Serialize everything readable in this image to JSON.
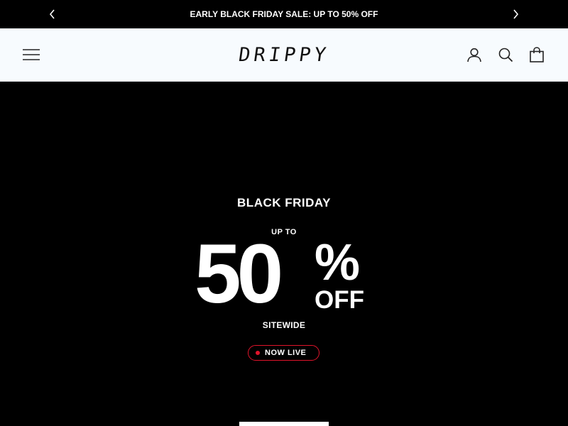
{
  "announcement": {
    "text": "EARLY BLACK FRIDAY SALE: UP TO 50% OFF",
    "prev_icon": "chevron-left-icon",
    "next_icon": "chevron-right-icon"
  },
  "header": {
    "logo": "DRIPPY",
    "icons": [
      "hamburger-menu-icon",
      "user-icon",
      "search-icon",
      "shopping-bag-icon"
    ]
  },
  "hero": {
    "eyebrow": "BLACK FRIDAY",
    "up_to": "UP TO",
    "amount": "50",
    "percent": "%",
    "off": "OFF",
    "scope": "SITEWIDE",
    "live_badge": "NOW LIVE"
  },
  "colors": {
    "background": "#000000",
    "header_bg": "#f7fbfe",
    "text": "#ffffff",
    "live_red": "#e0142b"
  }
}
